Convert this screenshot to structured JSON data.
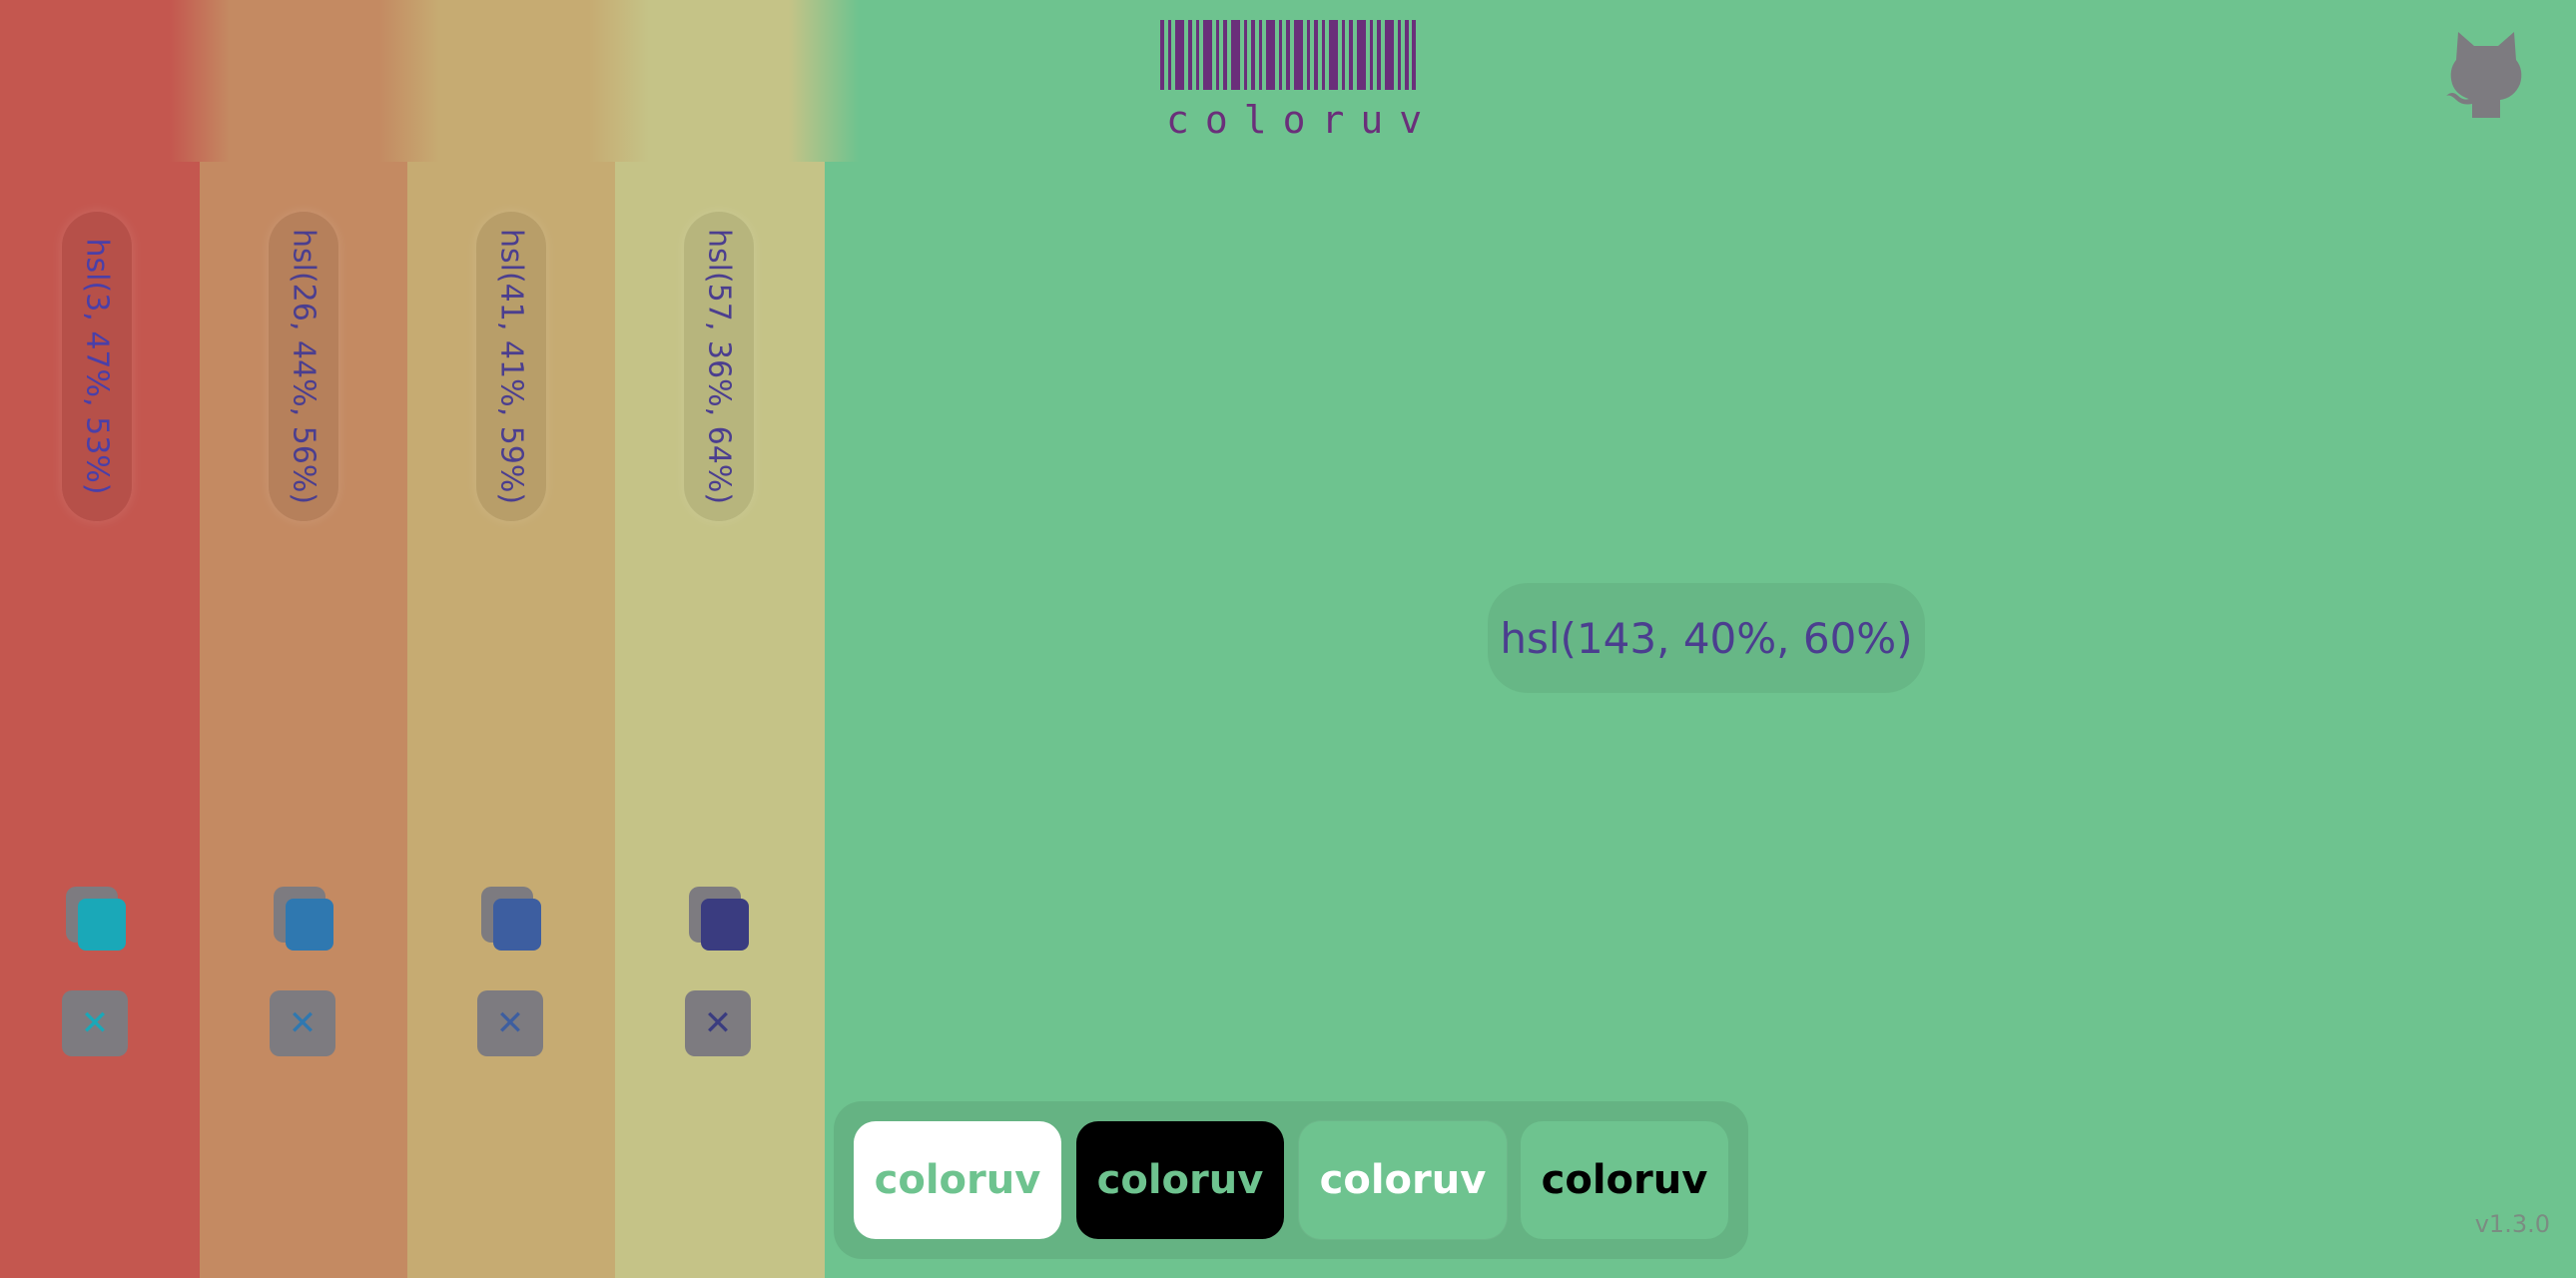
{
  "brand": {
    "name": "coloruv",
    "color": "#6a2f7a"
  },
  "background_color": "#6ec38f",
  "current_color": {
    "label": "hsl(143, 40%, 60%)"
  },
  "palette": [
    {
      "label": "hsl(3, 47%, 53%)",
      "color": "#c4574f",
      "picker_color": "#1aa8b8",
      "remove_label": "✕"
    },
    {
      "label": "hsl(26, 44%, 56%)",
      "color": "#c48a62",
      "picker_color": "#2f78b0",
      "remove_label": "✕"
    },
    {
      "label": "hsl(41, 41%, 59%)",
      "color": "#c6ab72",
      "picker_color": "#3d5ea0",
      "remove_label": "✕"
    },
    {
      "label": "hsl(57, 36%, 64%)",
      "color": "#c5c387",
      "picker_color": "#3a3c80",
      "remove_label": "✕"
    }
  ],
  "samples": [
    {
      "text": "coloruv",
      "bg": "#ffffff",
      "fg": "#6ec38f"
    },
    {
      "text": "coloruv",
      "bg": "#000000",
      "fg": "#6ec38f"
    },
    {
      "text": "coloruv",
      "bg": "#6ec38f",
      "fg": "#ffffff"
    },
    {
      "text": "coloruv",
      "bg": "#6ec38f",
      "fg": "#000000"
    }
  ],
  "icons": {
    "logo": "barcode-icon",
    "repo": "github-octocat-icon",
    "remove": "close-icon",
    "picker": "color-picker-icon"
  },
  "version": "v1.3.0"
}
